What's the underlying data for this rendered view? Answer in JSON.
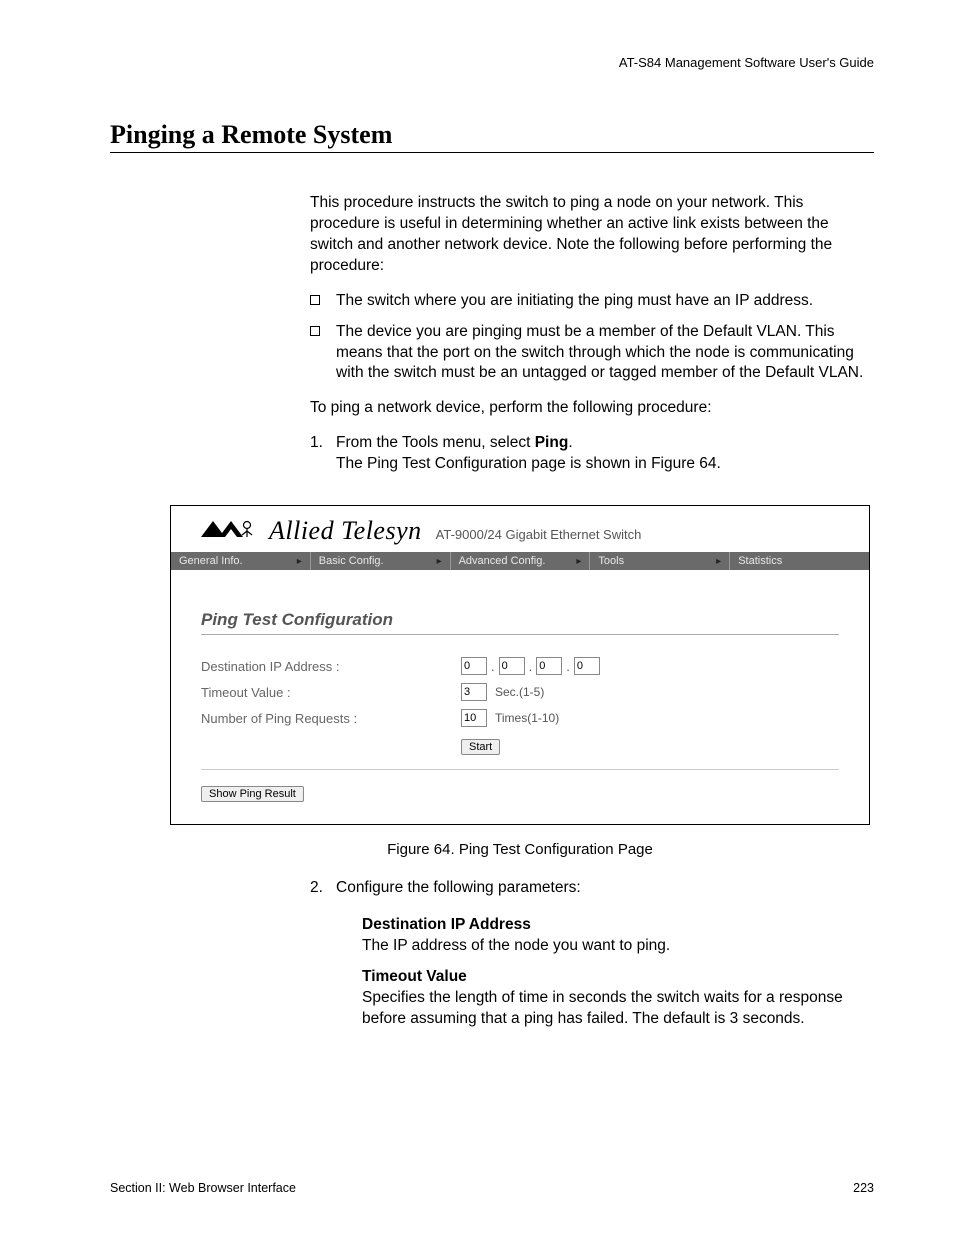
{
  "runningHead": "AT-S84 Management Software User's Guide",
  "sectionTitle": "Pinging a Remote System",
  "intro": "This procedure instructs the switch to ping a node on your network. This procedure is useful in determining whether an active link exists between the switch and another network device. Note the following before performing the procedure:",
  "bullets": [
    "The switch where you are initiating the ping must have an IP address.",
    "The device you are pinging must be a member of the Default VLAN. This means that the port on the switch through which the node is communicating with the switch must be an untagged or tagged member of the Default VLAN."
  ],
  "lead2": "To ping a network device, perform the following procedure:",
  "step1_pre": "From the Tools menu, select ",
  "step1_bold": "Ping",
  "step1_post": ".",
  "step1_result": "The Ping Test Configuration page is shown in Figure 64.",
  "figure": {
    "brand": "Allied Telesyn",
    "model": "AT-9000/24 Gigabit Ethernet Switch",
    "nav": [
      "General Info.",
      "Basic Config.",
      "Advanced Config.",
      "Tools",
      "Statistics"
    ],
    "panelTitle": "Ping Test Configuration",
    "rows": {
      "ip": {
        "label": "Destination IP Address :",
        "octets": [
          "0",
          "0",
          "0",
          "0"
        ]
      },
      "timeout": {
        "label": "Timeout Value :",
        "value": "3",
        "unit": "Sec.(1-5)"
      },
      "count": {
        "label": "Number of Ping Requests :",
        "value": "10",
        "unit": "Times(1-10)"
      }
    },
    "startBtn": "Start",
    "showResultBtn": "Show Ping Result"
  },
  "figCaption": "Figure 64. Ping Test Configuration Page",
  "step2": "Configure the following parameters:",
  "defs": [
    {
      "title": "Destination IP Address",
      "body": "The IP address of the node you want to ping."
    },
    {
      "title": "Timeout Value",
      "body": "Specifies the length of time in seconds the switch waits for a response before assuming that a ping has failed. The default is 3 seconds."
    }
  ],
  "footerLeft": "Section II: Web Browser Interface",
  "footerRight": "223"
}
